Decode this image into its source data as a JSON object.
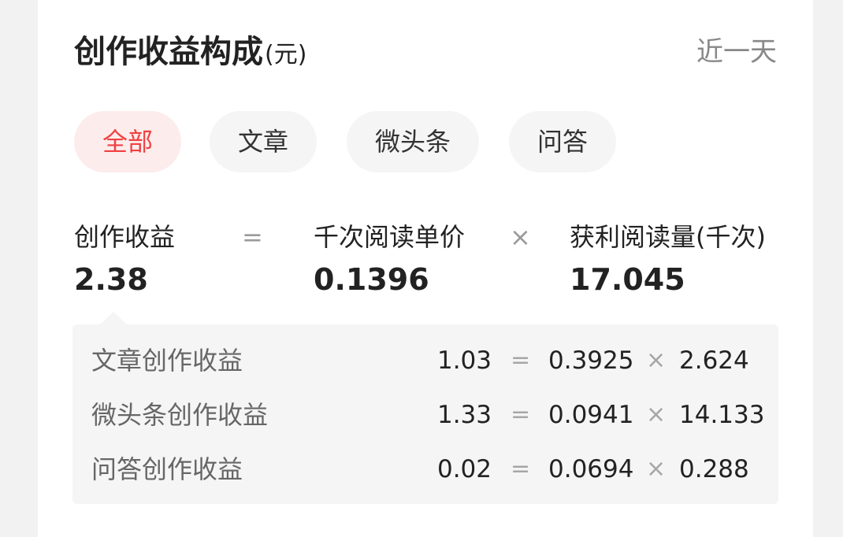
{
  "header": {
    "title": "创作收益构成",
    "unit": "(元)",
    "range": "近一天"
  },
  "tabs": [
    {
      "label": "全部",
      "active": true
    },
    {
      "label": "文章",
      "active": false
    },
    {
      "label": "微头条",
      "active": false
    },
    {
      "label": "问答",
      "active": false
    }
  ],
  "formula": {
    "earnings_label": "创作收益",
    "earnings_value": "2.38",
    "equals": "=",
    "price_label": "千次阅读单价",
    "price_value": "0.1396",
    "times": "×",
    "reads_label": "获利阅读量(千次)",
    "reads_value": "17.045"
  },
  "breakdown": [
    {
      "label": "文章创作收益",
      "earnings": "1.03",
      "equals": "=",
      "price": "0.3925",
      "times": "×",
      "reads": "2.624"
    },
    {
      "label": "微头条创作收益",
      "earnings": "1.33",
      "equals": "=",
      "price": "0.0941",
      "times": "×",
      "reads": "14.133"
    },
    {
      "label": "问答创作收益",
      "earnings": "0.02",
      "equals": "=",
      "price": "0.0694",
      "times": "×",
      "reads": "0.288"
    }
  ],
  "colors": {
    "accent": "#f04142",
    "active_tab_bg": "#fdecec",
    "tab_bg": "#f5f5f5",
    "page_bg": "#f2f2f2"
  }
}
